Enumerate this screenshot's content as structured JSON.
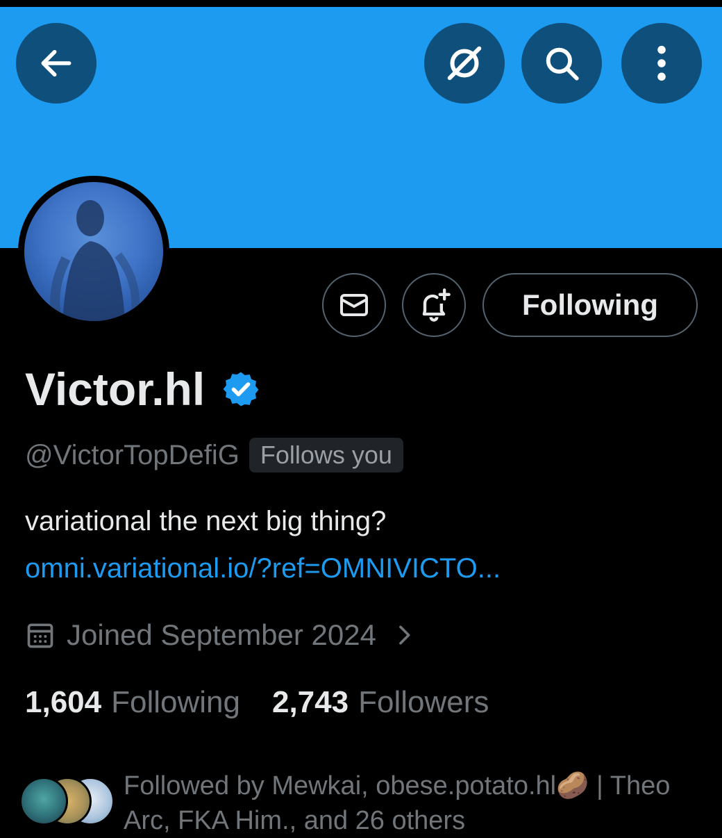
{
  "header": {
    "back_icon": "arrow-left-icon",
    "grok_icon": "grok-icon",
    "search_icon": "search-icon",
    "more_icon": "more-vertical-icon",
    "banner_color": "#1d9bf0"
  },
  "actions": {
    "message_icon": "envelope-icon",
    "notify_icon": "bell-plus-icon",
    "following_label": "Following"
  },
  "profile": {
    "name": "Victor.hl",
    "verified_icon": "verified-badge-icon",
    "handle": "@VictorTopDefiG",
    "follows_you": "Follows you",
    "bio": "variational the next big thing?",
    "link": "omni.variational.io/?ref=OMNIVICTO...",
    "joined": "Joined September 2024"
  },
  "stats": {
    "following_count": "1,604",
    "following_label": "Following",
    "followers_count": "2,743",
    "followers_label": "Followers"
  },
  "followed_by": {
    "text": "Followed by Mewkai, obese.potato.hl🥔 | Theo Arc, FKA Him., and 26 others"
  },
  "colors": {
    "accent": "#1d9bf0",
    "secondary_text": "#71767b",
    "primary_text": "#e7e9ea"
  }
}
